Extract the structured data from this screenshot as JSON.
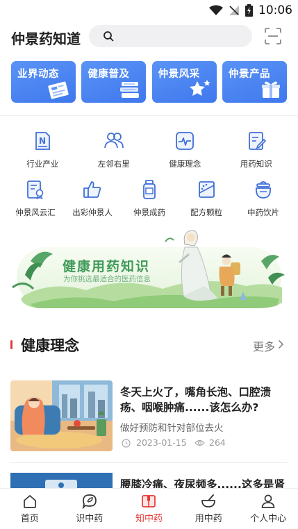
{
  "status_bar": {
    "time": "10:06"
  },
  "header": {
    "app_title": "仲景药知道",
    "search_placeholder": ""
  },
  "categories": [
    {
      "label": "业界动态",
      "icon": "newspaper-icon"
    },
    {
      "label": "健康普及",
      "icon": "books-icon"
    },
    {
      "label": "仲景风采",
      "icon": "star-icon"
    },
    {
      "label": "仲景产品",
      "icon": "gift-icon"
    }
  ],
  "grid": {
    "row1": [
      {
        "label": "行业产业",
        "icon": "document-icon"
      },
      {
        "label": "左邻右里",
        "icon": "people-icon"
      },
      {
        "label": "健康理念",
        "icon": "heartbeat-icon"
      },
      {
        "label": "用药知识",
        "icon": "notepad-icon"
      }
    ],
    "row2": [
      {
        "label": "仲景风云汇",
        "icon": "certificate-icon"
      },
      {
        "label": "出彩仲景人",
        "icon": "thumbs-up-icon"
      },
      {
        "label": "仲景成药",
        "icon": "medicine-bottle-icon"
      },
      {
        "label": "配方颗粒",
        "icon": "granules-icon"
      },
      {
        "label": "中药饮片",
        "icon": "herb-pot-icon"
      }
    ]
  },
  "banner": {
    "title": "健康用药知识",
    "subtitle": "为你挑选最适合的医药信息"
  },
  "section": {
    "title": "健康理念",
    "more": "更多"
  },
  "articles": [
    {
      "title": "冬天上火了，嘴角长泡、口腔溃疡、咽喉肿痛......该怎么办?",
      "subtitle": "做好预防和针对部位去火",
      "date": "2023-01-15",
      "views": "264"
    },
    {
      "title": "腰膝冷痛、夜尿频多......这多是肾"
    }
  ],
  "tabbar": [
    {
      "label": "首页",
      "icon": "home-icon",
      "active": false
    },
    {
      "label": "识中药",
      "icon": "chat-leaf-icon",
      "active": false
    },
    {
      "label": "知中药",
      "icon": "book-icon",
      "active": true
    },
    {
      "label": "用中药",
      "icon": "mortar-icon",
      "active": false
    },
    {
      "label": "个人中心",
      "icon": "user-icon",
      "active": false
    }
  ],
  "colors": {
    "accent_blue": "#4a86f2",
    "active_red": "#e53935",
    "banner_green": "#3f9a59"
  }
}
